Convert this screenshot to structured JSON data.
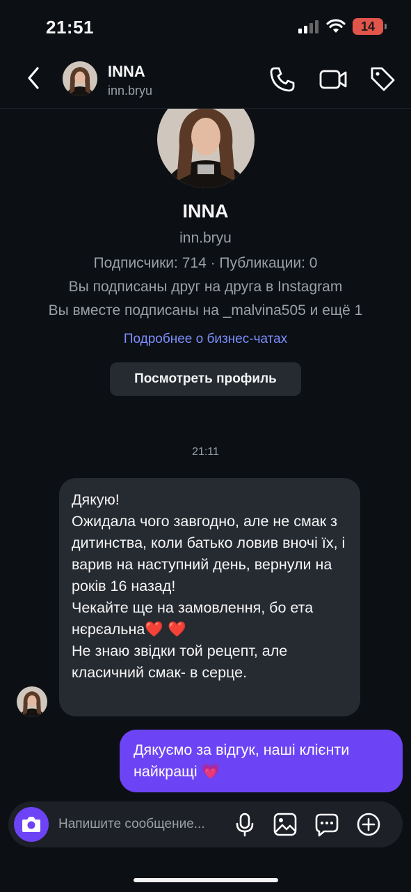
{
  "status_bar": {
    "time": "21:51",
    "battery": "14"
  },
  "header": {
    "name": "INNA",
    "username": "inn.bryu"
  },
  "profile": {
    "name": "INNA",
    "username": "inn.bryu",
    "stats": "Подписчики: 714 · Публикации: 0",
    "mutual_follow": "Вы подписаны друг на друга в Instagram",
    "mutual_following": "Вы вместе подписаны на _malvina505 и ещё 1",
    "business_link": "Подробнее о бизнес-чатах",
    "view_profile_label": "Посмотреть профиль"
  },
  "chat": {
    "timestamp": "21:11",
    "incoming_text": "Дякую!\nОжидала чого завгодно, але не смак з дитинства, коли батько ловив вночі їх, і варив на наступний день, вернули на років 16 назад!\nЧекайте ще на замовлення, бо ета нєрєальна",
    "incoming_hearts": "❤️ ❤️",
    "incoming_tail": "Не знаю звідки той рецепт, але класичний смак- в серце.",
    "outgoing_text": "Дякуємо за відгук, наші клієнти найкращі ",
    "outgoing_emoji": "💗"
  },
  "composer": {
    "placeholder": "Напишите сообщение..."
  },
  "colors": {
    "accent": "#6d44f5",
    "background": "#0c0f14",
    "bubble_in": "#262a31",
    "link": "#7c8fff"
  }
}
